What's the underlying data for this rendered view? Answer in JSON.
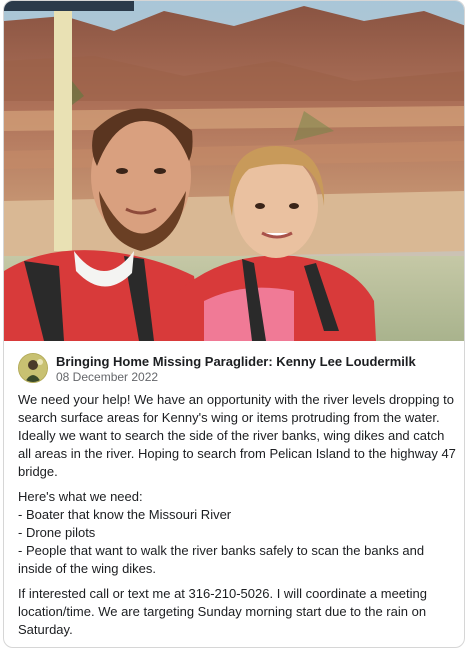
{
  "post": {
    "author": "Bringing Home Missing Paraglider: Kenny Lee Loudermilk",
    "date": "08 December 2022",
    "paragraph1": "We need your help!  We have an opportunity with the river levels dropping to search surface areas for Kenny's wing or items protruding from the water. Ideally we want to search the side of the river banks, wing dikes and catch all areas in the river. Hoping to search from Pelican Island to the highway 47 bridge.",
    "needs_heading": "Here's what we need:",
    "needs": [
      "- Boater that know the Missouri River",
      "- Drone pilots",
      "- People that want to walk the river banks safely to scan the banks and inside of the wing dikes."
    ],
    "paragraph3": "If interested call or text me at 316-210-5026. I will coordinate a meeting location/time. We are targeting Sunday morning start due to the rain on Saturday."
  },
  "colors": {
    "author_text": "#1c1e21",
    "date_text": "#65676b",
    "card_border": "#d6d6d6"
  },
  "icons": {
    "avatar": "avatar-photo"
  }
}
